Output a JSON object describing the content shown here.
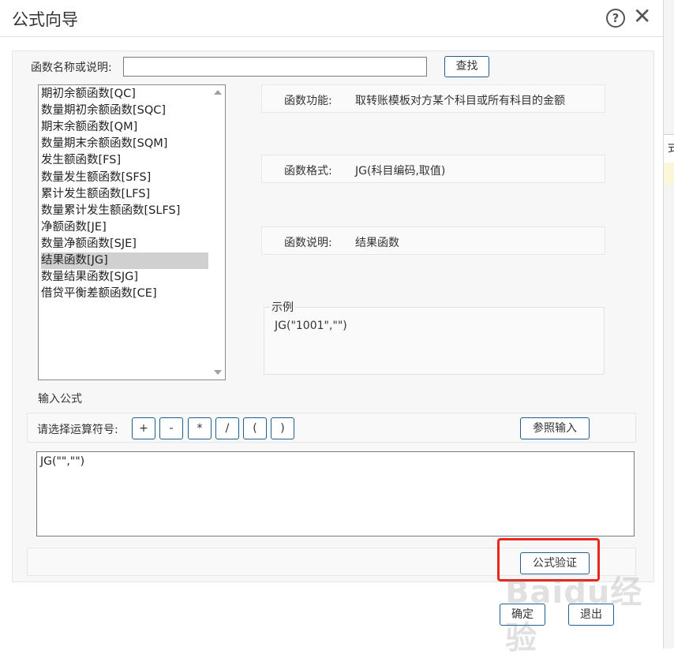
{
  "background": {
    "right_glyph": "式",
    "top_text": "—— ——"
  },
  "dialog": {
    "title": "公式向导",
    "help_icon": "question-circle",
    "close_icon": "close-x"
  },
  "search": {
    "label": "函数名称或说明:",
    "value": "",
    "button_label": "查找"
  },
  "function_list": {
    "selected": "结果函数[JG]",
    "items": [
      "期初余额函数[QC]",
      "数量期初余额函数[SQC]",
      "期末余额函数[QM]",
      "数量期末余额函数[SQM]",
      "发生额函数[FS]",
      "数量发生额函数[SFS]",
      "累计发生额函数[LFS]",
      "数量累计发生额函数[SLFS]",
      "净额函数[JE]",
      "数量净额函数[SJE]",
      "结果函数[JG]",
      "数量结果函数[SJG]",
      "借贷平衡差额函数[CE]"
    ]
  },
  "info": {
    "function_label": "函数功能:",
    "function_value": "取转账模板对方某个科目或所有科目的金额",
    "format_label": "函数格式:",
    "format_value": "JG(科目编码,取值)",
    "desc_label": "函数说明:",
    "desc_value": "结果函数"
  },
  "example": {
    "legend": "示例",
    "code": "JG(\"1001\",\"\")"
  },
  "formula": {
    "section_label": "输入公式",
    "operator_label": "请选择运算符号:",
    "operators": [
      "+",
      "-",
      "*",
      "/",
      "(",
      ")"
    ],
    "reference_button": "参照输入",
    "value": "JG(\"\",\"\")",
    "verify_button": "公式验证"
  },
  "footer": {
    "ok_button": "确定",
    "exit_button": "退出"
  },
  "colors": {
    "highlight": "#e8281e",
    "button_border": "#1f5f8b",
    "selection": "#d0d0d0"
  },
  "watermark": "Baidu经验"
}
